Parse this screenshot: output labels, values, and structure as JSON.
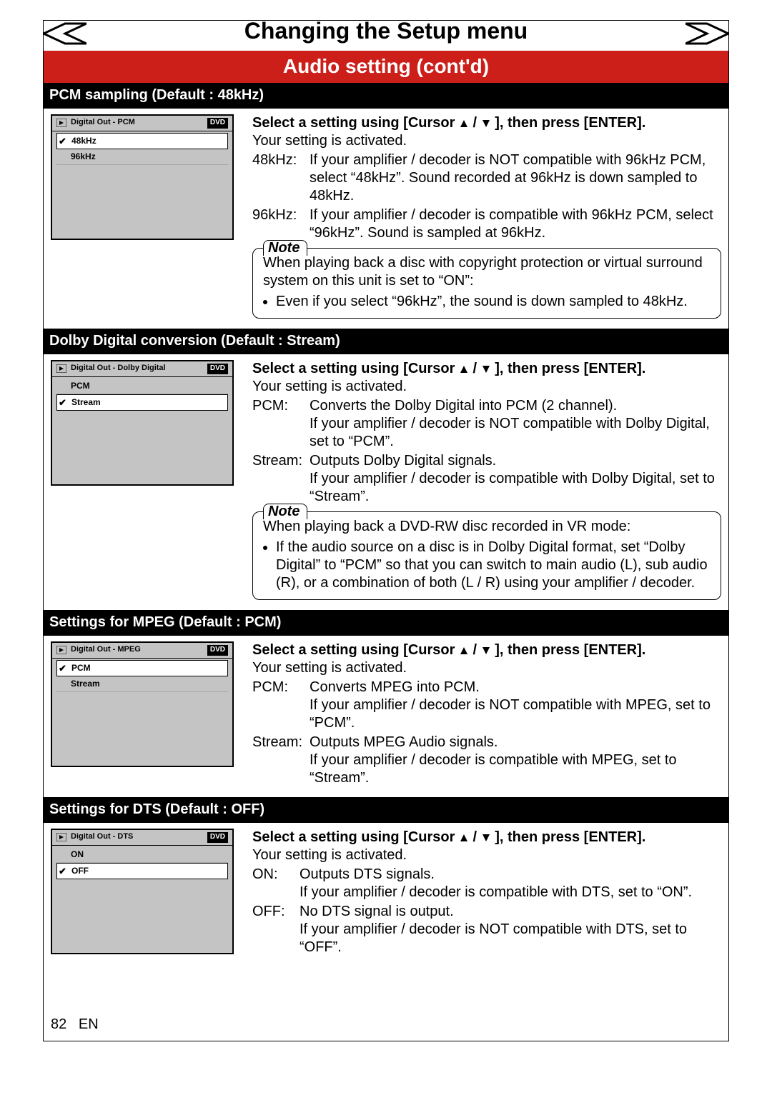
{
  "chapter_title": "Changing the Setup menu",
  "sub_banner": "Audio setting (cont'd)",
  "page_number": "82",
  "page_lang": "EN",
  "common": {
    "instruction_prefix": "Select a setting using [Cursor ",
    "instruction_suffix": " ], then press [ENTER].",
    "instruction_slash": " / ",
    "activated": "Your setting is activated.",
    "note_label": "Note",
    "dvd_tag": "DVD"
  },
  "sections": {
    "pcm": {
      "heading": "PCM sampling (Default : 48kHz)",
      "tv_title": "Digital Out - PCM",
      "tv_rows": [
        {
          "checked": true,
          "label": "48kHz"
        },
        {
          "checked": false,
          "label": "96kHz"
        }
      ],
      "definitions": [
        {
          "key": "48kHz:",
          "val": "If your amplifier / decoder is NOT compatible with 96kHz PCM, select “48kHz”. Sound recorded at 96kHz is down sampled to 48kHz."
        },
        {
          "key": "96kHz:",
          "val": "If your amplifier / decoder is compatible with 96kHz PCM, select “96kHz”. Sound is sampled at 96kHz."
        }
      ],
      "note_lead": "When playing back a disc with copyright protection or virtual surround system on this unit is set to “ON”:",
      "note_items": [
        "Even if you select “96kHz”, the sound is down sampled to 48kHz."
      ]
    },
    "dolby": {
      "heading": "Dolby Digital conversion (Default : Stream)",
      "tv_title": "Digital Out - Dolby Digital",
      "tv_rows": [
        {
          "checked": false,
          "label": "PCM"
        },
        {
          "checked": true,
          "label": "Stream"
        }
      ],
      "definitions": [
        {
          "key": "PCM:",
          "val": "Converts the Dolby Digital into PCM (2 channel).\nIf your amplifier / decoder is NOT compatible with Dolby Digital, set to “PCM”."
        },
        {
          "key": "Stream:",
          "val": "Outputs Dolby Digital signals.\nIf your amplifier / decoder is compatible with Dolby Digital, set to “Stream”."
        }
      ],
      "note_lead": "When playing back a DVD-RW disc recorded in VR mode:",
      "note_items": [
        "If the audio source on a disc is in Dolby Digital format, set “Dolby Digital” to “PCM” so that you can switch to main audio (L), sub audio (R), or a combination of both (L / R) using your amplifier / decoder."
      ]
    },
    "mpeg": {
      "heading": "Settings for MPEG (Default : PCM)",
      "tv_title": "Digital Out - MPEG",
      "tv_rows": [
        {
          "checked": true,
          "label": "PCM"
        },
        {
          "checked": false,
          "label": "Stream"
        }
      ],
      "definitions": [
        {
          "key": "PCM:",
          "val": "Converts MPEG into PCM.\nIf your amplifier / decoder is NOT compatible with MPEG, set to “PCM”."
        },
        {
          "key": "Stream:",
          "val": "Outputs MPEG Audio signals.\nIf your amplifier / decoder is compatible with MPEG, set to “Stream”."
        }
      ]
    },
    "dts": {
      "heading": "Settings for DTS (Default : OFF)",
      "tv_title": "Digital Out - DTS",
      "tv_rows": [
        {
          "checked": false,
          "label": "ON"
        },
        {
          "checked": true,
          "label": "OFF"
        }
      ],
      "definitions": [
        {
          "key": "ON:",
          "val": "Outputs DTS signals.\nIf your amplifier / decoder is compatible with DTS, set to “ON”."
        },
        {
          "key": "OFF:",
          "val": "No DTS signal is output.\nIf your amplifier / decoder is NOT compatible with DTS, set to “OFF”."
        }
      ]
    }
  }
}
